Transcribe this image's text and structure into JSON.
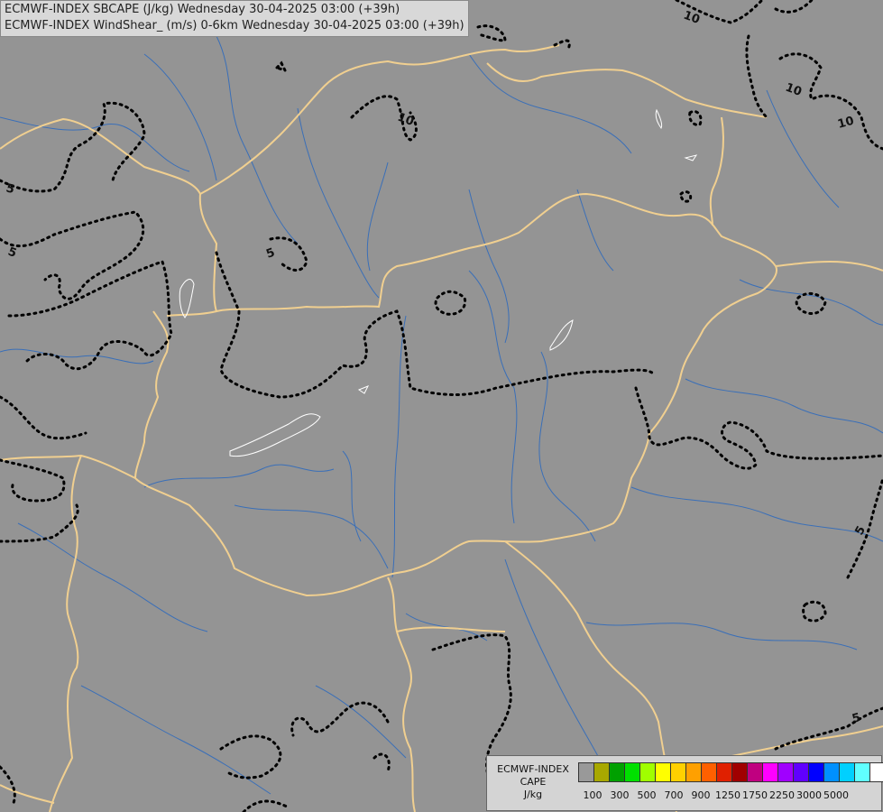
{
  "header": {
    "line1": "ECMWF-INDEX SBCAPE (J/kg) Wednesday 30-04-2025 03:00 (+39h)",
    "line2": "ECMWF-INDEX WindShear_ (m/s) 0-6km Wednesday 30-04-2025 03:00 (+39h)"
  },
  "legend": {
    "source": "ECMWF-INDEX",
    "name": "CAPE",
    "unit": "J/kg",
    "colors": [
      "#999999",
      "#a8a800",
      "#00a000",
      "#00e000",
      "#a0ff00",
      "#ffff00",
      "#ffd000",
      "#ffa000",
      "#ff6000",
      "#e02000",
      "#a00000",
      "#c00080",
      "#ff00ff",
      "#a000ff",
      "#6000ff",
      "#0000ff",
      "#0090ff",
      "#00d0ff",
      "#60ffff",
      "#ffffff"
    ],
    "tick_labels": [
      "100",
      "300",
      "500",
      "700",
      "900",
      "1250",
      "1750",
      "2250",
      "3000",
      "5000"
    ]
  },
  "contour_labels": [
    "10",
    "10",
    "10",
    "10",
    "5",
    "5",
    "5",
    "5",
    "5"
  ],
  "colors": {
    "background": "#949494",
    "borders": "#f0cf90",
    "rivers": "#3a6fb8",
    "contours": "#000000"
  }
}
